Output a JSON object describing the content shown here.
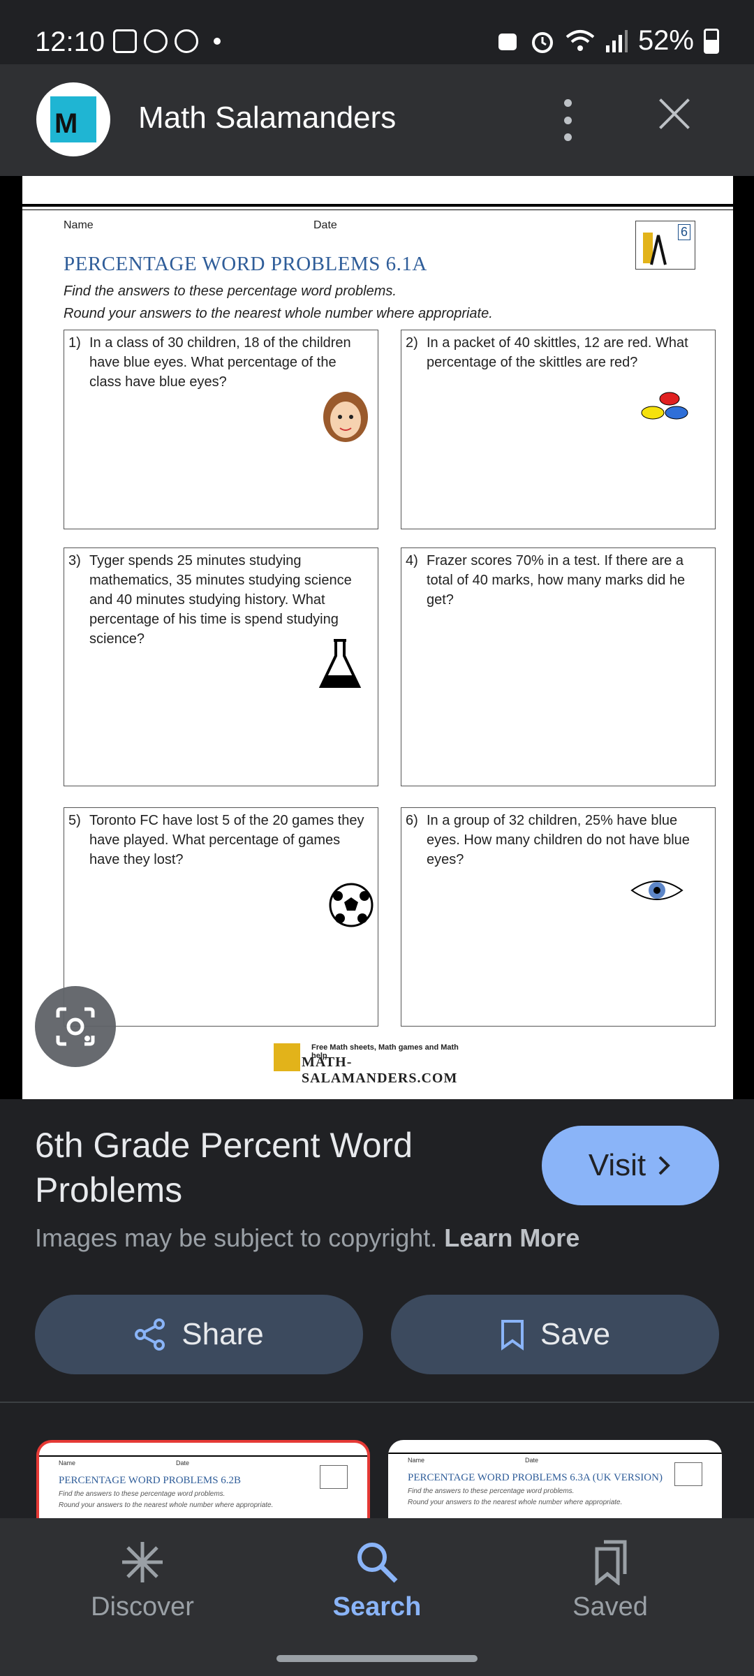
{
  "status_bar": {
    "time": "12:10",
    "battery": "52%"
  },
  "header": {
    "site_name": "Math Salamanders"
  },
  "worksheet": {
    "name_label": "Name",
    "date_label": "Date",
    "badge_number": "6",
    "title": "PERCENTAGE WORD PROBLEMS 6.1A",
    "instruction_1": "Find the answers to these percentage word problems.",
    "instruction_2": "Round your answers to the nearest whole number where appropriate.",
    "questions": [
      {
        "num": "1)",
        "text": "In a class of 30 children, 18 of the children have blue eyes. What percentage of the class have blue eyes?"
      },
      {
        "num": "2)",
        "text": "In a packet of 40 skittles, 12 are red. What percentage of the skittles are red?"
      },
      {
        "num": "3)",
        "text": "Tyger spends 25 minutes studying mathematics, 35 minutes studying science and 40 minutes studying history. What percentage of his time is spend studying science?"
      },
      {
        "num": "4)",
        "text": "Frazer scores 70% in a test. If there are a total of 40 marks, how many marks did he get?"
      },
      {
        "num": "5)",
        "text": "Toronto FC have lost 5 of the 20 games they have played. What percentage of games have they lost?"
      },
      {
        "num": "6)",
        "text": "In a group of 32 children, 25% have blue eyes. How many children do not have blue eyes?"
      }
    ],
    "footer_small": "Free Math sheets, Math games and Math help",
    "footer_big": "MATH-SALAMANDERS.COM"
  },
  "info": {
    "title": "6th Grade Percent Word Problems",
    "visit_label": "Visit",
    "copyright_text": "Images may be subject to copyright.",
    "learn_more": "Learn More",
    "share_label": "Share",
    "save_label": "Save"
  },
  "related": [
    {
      "name": "Name",
      "date": "Date",
      "title": "PERCENTAGE WORD PROBLEMS 6.2B",
      "line1": "Find the answers to these percentage word problems.",
      "line2": "Round your answers to the nearest whole number where appropriate."
    },
    {
      "name": "Name",
      "date": "Date",
      "title": "PERCENTAGE WORD PROBLEMS 6.3A (UK VERSION)",
      "line1": "Find the answers to these percentage word problems.",
      "line2": "Round your answers to the nearest whole number where appropriate."
    }
  ],
  "bottom_nav": [
    {
      "label": "Discover",
      "icon": "asterisk-icon"
    },
    {
      "label": "Search",
      "icon": "search-icon"
    },
    {
      "label": "Saved",
      "icon": "bookmarks-icon"
    }
  ],
  "colors": {
    "accent": "#8ab4f8",
    "background": "#202124",
    "button": "#3c4a5e",
    "worksheet_title": "#2f5d99"
  }
}
